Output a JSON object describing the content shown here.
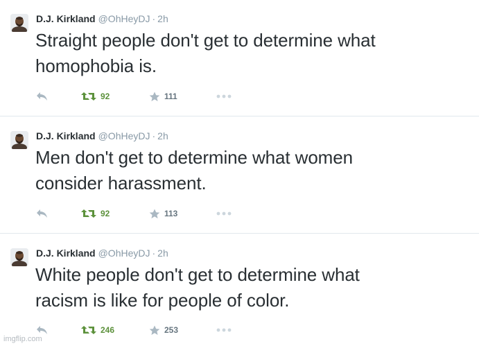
{
  "tweets": [
    {
      "name": "D.J. Kirkland",
      "handle": "@OhHeyDJ",
      "separator": "·",
      "time": "2h",
      "line1": "Straight people don't get to determine what",
      "line2": "homophobia is.",
      "retweets": "92",
      "favorites": "111"
    },
    {
      "name": "D.J. Kirkland",
      "handle": "@OhHeyDJ",
      "separator": "·",
      "time": "2h",
      "line1": "Men don't get to determine what women",
      "line2": "consider harassment.",
      "retweets": "92",
      "favorites": "113"
    },
    {
      "name": "D.J. Kirkland",
      "handle": "@OhHeyDJ",
      "separator": "·",
      "time": "2h",
      "line1": "White people don't get to determine what",
      "line2": "racism is like for people of color.",
      "retweets": "246",
      "favorites": "253"
    }
  ],
  "watermark": "imgflip.com",
  "icons": [
    "reply-icon",
    "retweet-icon",
    "star-icon",
    "more-icon"
  ],
  "colors": {
    "retweet": "#5c913b",
    "icon": "#aab8c2",
    "handle": "#8899a6",
    "text": "#292f33"
  }
}
